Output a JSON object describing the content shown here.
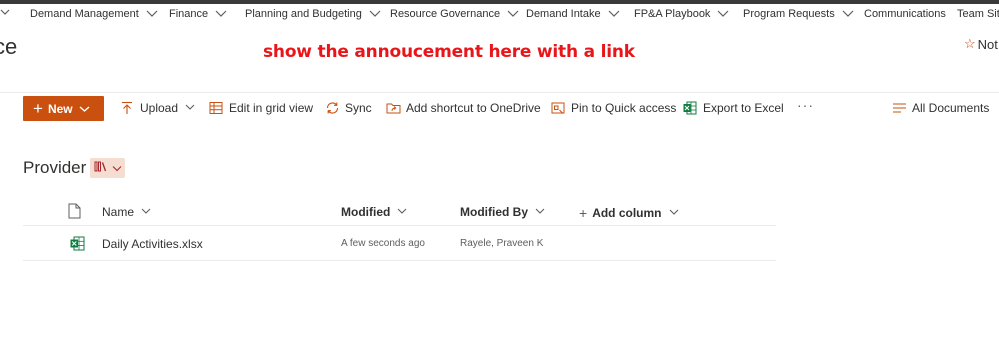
{
  "nav": {
    "items": [
      {
        "label": "Demand Management",
        "chevron": true
      },
      {
        "label": "Finance",
        "chevron": true
      },
      {
        "label": "Planning and Budgeting",
        "chevron": true
      },
      {
        "label": "Resource Governance",
        "chevron": true
      },
      {
        "label": "Demand Intake",
        "chevron": true
      },
      {
        "label": "FP&A Playbook",
        "chevron": true
      },
      {
        "label": "Program Requests",
        "chevron": true
      },
      {
        "label": "Communications",
        "chevron": false
      },
      {
        "label": "Team Site",
        "chevron": false
      }
    ]
  },
  "header": {
    "site_title_fragment": "ce",
    "announcement": "show the annoucement here with a link",
    "follow_label": "Not"
  },
  "command_bar": {
    "new_label": "New",
    "upload_label": "Upload",
    "grid_label": "Edit in grid view",
    "sync_label": "Sync",
    "shortcut_label": "Add shortcut to OneDrive",
    "pin_label": "Pin to Quick access",
    "export_label": "Export to Excel",
    "more_label": "···",
    "view_label": "All Documents"
  },
  "library": {
    "title": "Provider"
  },
  "list": {
    "columns": {
      "name": "Name",
      "modified": "Modified",
      "modified_by": "Modified By",
      "add_column": "Add column"
    },
    "rows": [
      {
        "name": "Daily Activities.xlsx",
        "modified": "A few seconds ago",
        "modified_by": "Rayele, Praveen K"
      }
    ]
  },
  "colors": {
    "accent": "#ca5010",
    "announcement": "#e8161a",
    "excel_green": "#107c41"
  }
}
